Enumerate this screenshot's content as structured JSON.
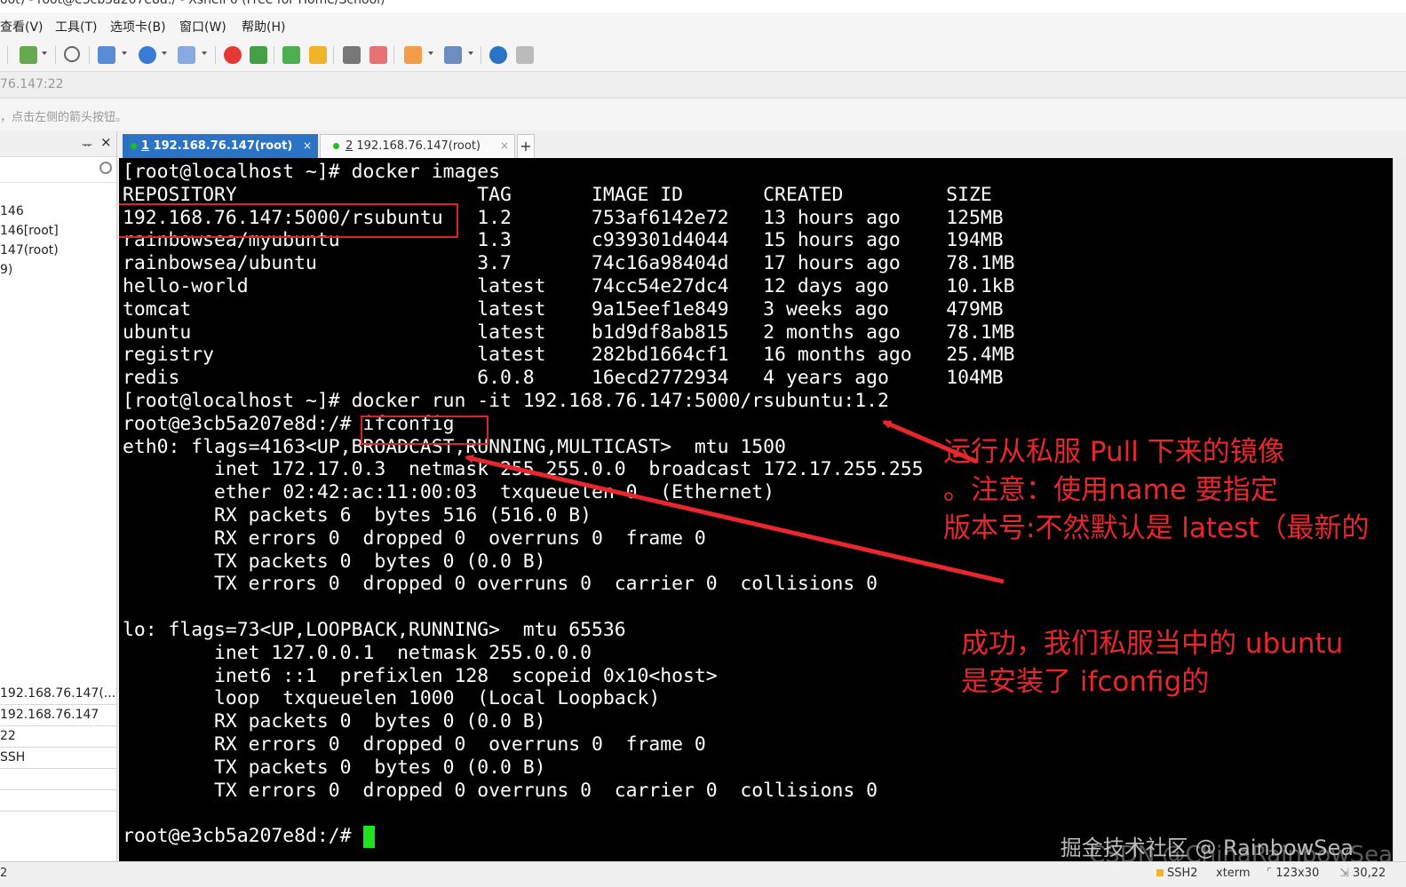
{
  "window": {
    "title": "oot) - root@e3cb5a207e8d:/ - Xshell 6 (Free for Home/School)"
  },
  "menu": {
    "view": "查看(V)",
    "tools": "工具(T)",
    "tabs": "选项卡(B)",
    "window": "窗口(W)",
    "help": "帮助(H)"
  },
  "toolbar": {
    "icons": [
      "new-session-icon",
      "search-icon",
      "layout-icon",
      "globe-icon",
      "font-icon",
      "xftp-icon",
      "xagent-icon",
      "fullscreen-icon",
      "lock-icon",
      "keyboard-icon",
      "highlight-icon",
      "compose-icon",
      "tile-icon",
      "help-icon",
      "chat-icon"
    ]
  },
  "address": {
    "value": "76.147:22"
  },
  "hint": {
    "text": "，点击左侧的箭头按钮。"
  },
  "sidebar": {
    "pin": "ᅲ",
    "close": "×",
    "items": [
      "146",
      "146[root]",
      "147(root)",
      "9)"
    ],
    "properties": [
      "192.168.76.147(...",
      "192.168.76.147",
      "22",
      "SSH",
      "",
      ""
    ]
  },
  "tabs": [
    {
      "num": "1",
      "label": " 192.168.76.147(root)",
      "close": "×"
    },
    {
      "num": "2",
      "label": " 192.168.76.147(root)",
      "close": "×"
    }
  ],
  "tab_add": "+",
  "terminal": {
    "lines": [
      "[root@localhost ~]# docker images",
      "REPOSITORY                     TAG       IMAGE ID       CREATED         SIZE",
      "192.168.76.147:5000/rsubuntu   1.2       753af6142e72   13 hours ago    125MB",
      "rainbowsea/myubuntu            1.3       c939301d4044   15 hours ago    194MB",
      "rainbowsea/ubuntu              3.7       74c16a98404d   17 hours ago    78.1MB",
      "hello-world                    latest    74cc54e27dc4   12 days ago     10.1kB",
      "tomcat                         latest    9a15eef1e849   3 weeks ago     479MB",
      "ubuntu                         latest    b1d9df8ab815   2 months ago    78.1MB",
      "registry                       latest    282bd1664cf1   16 months ago   25.4MB",
      "redis                          6.0.8     16ecd2772934   4 years ago     104MB",
      "[root@localhost ~]# docker run -it 192.168.76.147:5000/rsubuntu:1.2",
      "root@e3cb5a207e8d:/# ifconfig",
      "eth0: flags=4163<UP,BROADCAST,RUNNING,MULTICAST>  mtu 1500",
      "        inet 172.17.0.3  netmask 255.255.0.0  broadcast 172.17.255.255",
      "        ether 02:42:ac:11:00:03  txqueuelen 0  (Ethernet)",
      "        RX packets 6  bytes 516 (516.0 B)",
      "        RX errors 0  dropped 0  overruns 0  frame 0",
      "        TX packets 0  bytes 0 (0.0 B)",
      "        TX errors 0  dropped 0 overruns 0  carrier 0  collisions 0",
      "",
      "lo: flags=73<UP,LOOPBACK,RUNNING>  mtu 65536",
      "        inet 127.0.0.1  netmask 255.0.0.0",
      "        inet6 ::1  prefixlen 128  scopeid 0x10<host>",
      "        loop  txqueuelen 1000  (Local Loopback)",
      "        RX packets 0  bytes 0 (0.0 B)",
      "        RX errors 0  dropped 0  overruns 0  frame 0",
      "        TX packets 0  bytes 0 (0.0 B)",
      "        TX errors 0  dropped 0 overruns 0  carrier 0  collisions 0",
      "",
      "root@e3cb5a207e8d:/# "
    ]
  },
  "annotations": {
    "run_note": [
      "运行从私服 Pull 下来的镜像",
      "。注意：使用name 要指定",
      "版本号:不然默认是 latest（最新的"
    ],
    "success_note": [
      "成功，我们私服当中的 ubuntu",
      "是安装了 ifconfig的"
    ],
    "color": "#e8262c"
  },
  "watermark": {
    "line1": "掘金技术社区 @ RainbowSea",
    "line2": "CSDN @ChinaRainbowSea"
  },
  "status": {
    "protocol": "SSH2",
    "term": "xterm",
    "size": "123x30",
    "cursor": "30,22"
  }
}
